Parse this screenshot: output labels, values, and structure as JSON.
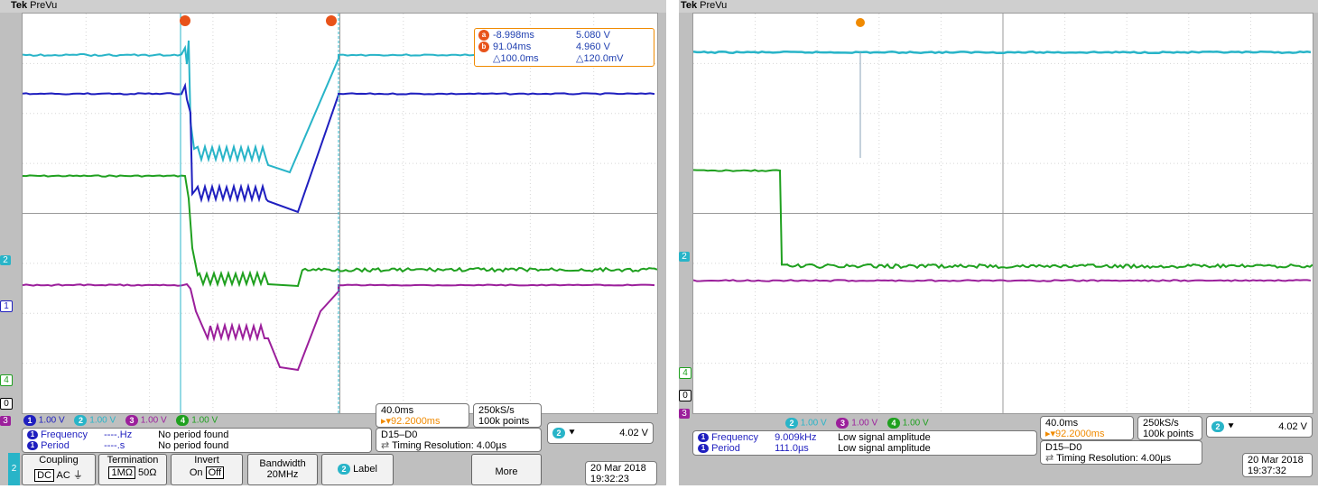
{
  "left": {
    "brand": "Tek",
    "mode": "PreVu",
    "cursors": {
      "a_label": "a",
      "b_label": "b",
      "a_time": "-8.998ms",
      "a_volt": "5.080 V",
      "b_time": "91.04ms",
      "b_volt": "4.960 V",
      "d_time": "△100.0ms",
      "d_volt": "△120.0mV"
    },
    "channel_markers": [
      "2",
      "1",
      "4",
      "0",
      "3"
    ],
    "status": [
      {
        "num": "1",
        "volt": "1.00 V",
        "color": "#1f1fbf"
      },
      {
        "num": "2",
        "volt": "1.00 V",
        "color": "#28b4c8"
      },
      {
        "num": "3",
        "volt": "1.00 V",
        "color": "#9b1f9b"
      },
      {
        "num": "4",
        "volt": "1.00 V",
        "color": "#1fa01f"
      }
    ],
    "measurements": [
      {
        "name": "Frequency",
        "value": "----.Hz",
        "note": "No period found"
      },
      {
        "name": "Period",
        "value": "----.s",
        "note": "No period found"
      }
    ],
    "timebase": "40.0ms",
    "trigger_pos": "▸▾92.2000ms",
    "sample_rate": "250kS/s",
    "record": "100k points",
    "digital": "D15–D0",
    "timing_res": "Timing Resolution: 4.00µs",
    "trigger": {
      "ch": "2",
      "slope": "⯆",
      "level": "4.02 V"
    },
    "menu": {
      "ch_tab": "2",
      "coupling": "Coupling",
      "dc": "DC",
      "ac": "AC",
      "gnd": "⏚",
      "termination": "Termination",
      "t1": "1MΩ",
      "t2": "50Ω",
      "invert": "Invert",
      "on": "On",
      "off": "Off",
      "bandwidth": "Bandwidth",
      "bw_val": "20MHz",
      "label_ch": "2",
      "label": "Label",
      "more": "More"
    },
    "date": "20 Mar 2018",
    "time": "19:32:23"
  },
  "right": {
    "brand": "Tek",
    "mode": "PreVu",
    "channel_markers": [
      "2",
      "4",
      "0",
      "3"
    ],
    "status": [
      {
        "num": "2",
        "volt": "1.00 V",
        "color": "#28b4c8"
      },
      {
        "num": "3",
        "volt": "1.00 V",
        "color": "#9b1f9b"
      },
      {
        "num": "4",
        "volt": "1.00 V",
        "color": "#1fa01f"
      }
    ],
    "measurements": [
      {
        "name": "Frequency",
        "value": "9.009kHz",
        "note": "Low signal amplitude"
      },
      {
        "name": "Period",
        "value": "111.0µs",
        "note": "Low signal amplitude"
      }
    ],
    "timebase": "40.0ms",
    "trigger_pos": "▸▾92.2000ms",
    "sample_rate": "250kS/s",
    "record": "100k points",
    "digital": "D15–D0",
    "timing_res": "Timing Resolution: 4.00µs",
    "trigger": {
      "ch": "2",
      "slope": "⯆",
      "level": "4.02 V"
    },
    "date": "20 Mar 2018",
    "time": "19:37:32"
  },
  "colors": {
    "ch1": "#1f1fbf",
    "ch2": "#28b4c8",
    "ch3": "#9b1f9b",
    "ch4": "#1fa01f",
    "cursor": "#f08a00"
  }
}
